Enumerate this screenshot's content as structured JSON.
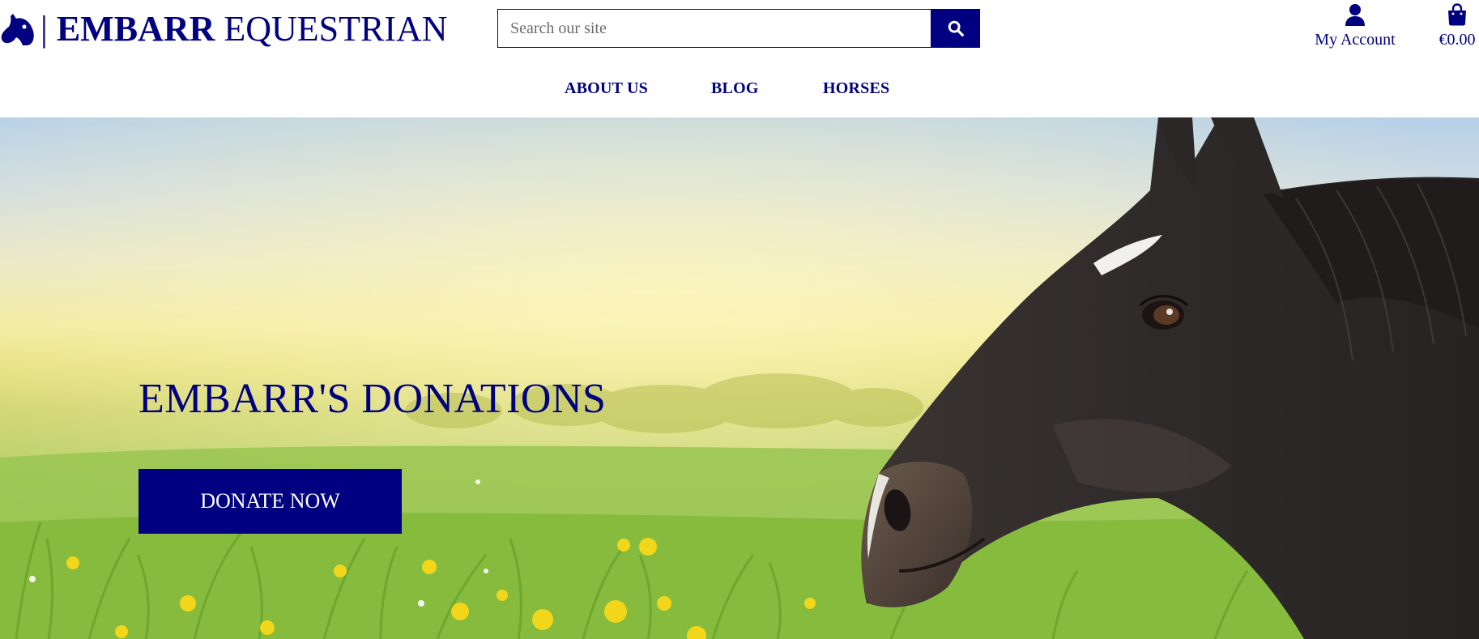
{
  "brand": {
    "name_bold": "EMBARR",
    "name_rest": "EQUESTRIAN",
    "separator": "|",
    "logo_icon": "horse-head-icon"
  },
  "search": {
    "placeholder": "Search our site",
    "value": "",
    "button_icon": "search-icon"
  },
  "account": {
    "label": "My Account",
    "icon": "user-icon"
  },
  "cart": {
    "total": "€0.00",
    "icon": "shopping-bag-icon"
  },
  "nav": {
    "items": [
      {
        "label": "ABOUT US"
      },
      {
        "label": "BLOG"
      },
      {
        "label": "HORSES"
      }
    ]
  },
  "hero": {
    "title": "EMBARR'S DONATIONS",
    "cta_label": "DONATE NOW",
    "image": "horse-in-meadow"
  },
  "colors": {
    "brand": "#000080",
    "background": "#ffffff",
    "button_text": "#ffffff"
  }
}
